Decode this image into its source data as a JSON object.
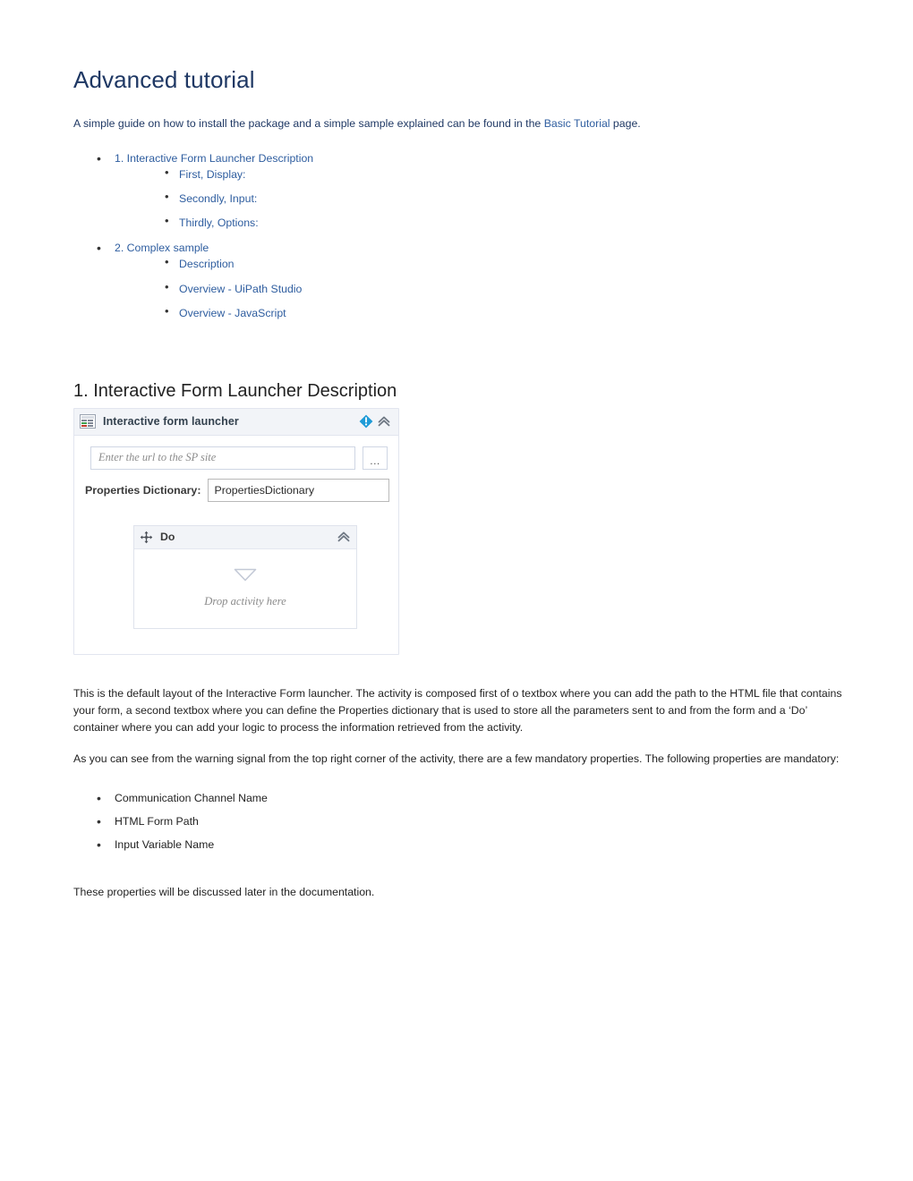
{
  "document": {
    "title": "Advanced tutorial",
    "intro": {
      "before": "A simple guide on how to install the package and a simple sample explained can be found in the ",
      "link": "Basic Tutorial",
      "after": " page."
    }
  },
  "toc": [
    {
      "label": "1. Interactive Form Launcher Description",
      "children": [
        {
          "label": "First, Display:"
        },
        {
          "label": "Secondly, Input:"
        },
        {
          "label": "Thirdly, Options:"
        }
      ]
    },
    {
      "label": "2. Complex sample",
      "children": [
        {
          "label": "Description"
        },
        {
          "label": "Overview - UiPath Studio"
        },
        {
          "label": "Overview - JavaScript"
        }
      ]
    }
  ],
  "section": {
    "heading": "1. Interactive Form Launcher Description",
    "activity": {
      "icon": "form-launcher-icon",
      "title": "Interactive form launcher",
      "warning_icon": "warning-exclamation-icon",
      "collapse_icon": "double-chevron-up-icon",
      "url_placeholder": "Enter the url to the SP site",
      "browse_button": "...",
      "properties_label": "Properties Dictionary:",
      "properties_value": "PropertiesDictionary",
      "do_container": {
        "icon": "move-arrows-icon",
        "title": "Do",
        "collapse_icon": "double-chevron-up-icon",
        "drop_icon": "drop-triangle-icon",
        "drop_text": "Drop activity here"
      }
    },
    "paragraph_1": "This is the default layout of the Interactive Form launcher. The activity is composed first of o textbox where you can add the path to the HTML file that contains your form, a second textbox where you can define the Properties dictionary that is used to store all the parameters sent to and from the form and a ‘Do’ container where you can add your logic to process the information retrieved from the activity.",
    "paragraph_2": "As you can see from the warning signal from the top right corner of the activity, there are a few mandatory properties. The following properties are mandatory:",
    "mandatory_properties": [
      "Communication Channel Name",
      "HTML Form Path",
      "Input Variable Name"
    ],
    "paragraph_3": "These properties will be discussed later in the documentation."
  },
  "colors": {
    "title": "#1f3864",
    "link": "#2e5d9f",
    "body_text": "#222222",
    "activity_header_bg": "#f2f4f8",
    "activity_border": "#e2e5ef",
    "warning_blue": "#1e9bd7"
  }
}
